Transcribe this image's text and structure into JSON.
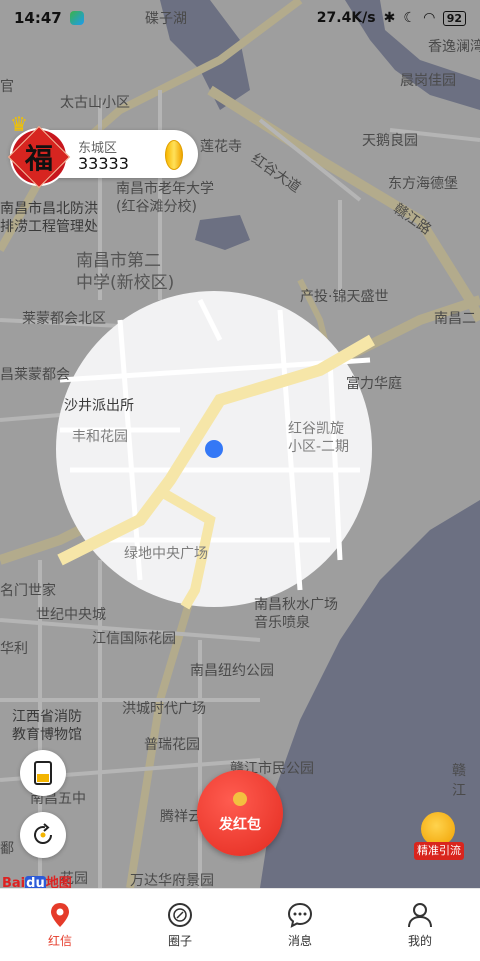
{
  "status_bar": {
    "time": "14:47",
    "speed": "27.4K/s",
    "battery": "92"
  },
  "user_card": {
    "badge_char": "福",
    "district": "东城区",
    "points": "33333"
  },
  "map": {
    "labels": [
      "碟子湖",
      "香逸澜湾",
      "晨岗佳园",
      "官",
      "太古山小区",
      "天鹅良园",
      "莲花寺",
      "东方海德堡",
      "南昌市老年大学",
      "(红谷滩分校)",
      "南昌市昌北防洪",
      "排涝工程管理处",
      "南昌市第二",
      "中学(新校区)",
      "产投·锦天盛世",
      "南昌二",
      "莱蒙都会北区",
      "富力华庭",
      "昌莱蒙都会",
      "沙井派出所",
      "红谷凯旋",
      "小区-二期",
      "丰和花园",
      "绿地中央广场",
      "南昌秋水广场",
      "音乐喷泉",
      "名门世家",
      "世纪中央城",
      "江信国际花园",
      "华利",
      "南昌纽约公园",
      "江西省消防",
      "教育博物馆",
      "洪城时代广场",
      "普瑞花园",
      "南昌五中",
      "赣江市民公园",
      "赣",
      "江",
      "腾祥云",
      "万达华府景园",
      "鄱",
      "花园",
      "红谷大道",
      "赣江路"
    ]
  },
  "buttons": {
    "send_red_packet": "发红包",
    "promo_tag": "精准引流"
  },
  "baidu": {
    "bai": "Bai",
    "du": "du",
    "map": "地图"
  },
  "tabs": [
    {
      "label": "红信",
      "icon": "location-pin-icon",
      "active": true
    },
    {
      "label": "圈子",
      "icon": "circle-compass-icon",
      "active": false
    },
    {
      "label": "消息",
      "icon": "chat-bubble-icon",
      "active": false
    },
    {
      "label": "我的",
      "icon": "person-icon",
      "active": false
    }
  ],
  "colors": {
    "accent": "#e53b2a",
    "location_dot": "#3478f6",
    "coin": "#f7b600"
  }
}
